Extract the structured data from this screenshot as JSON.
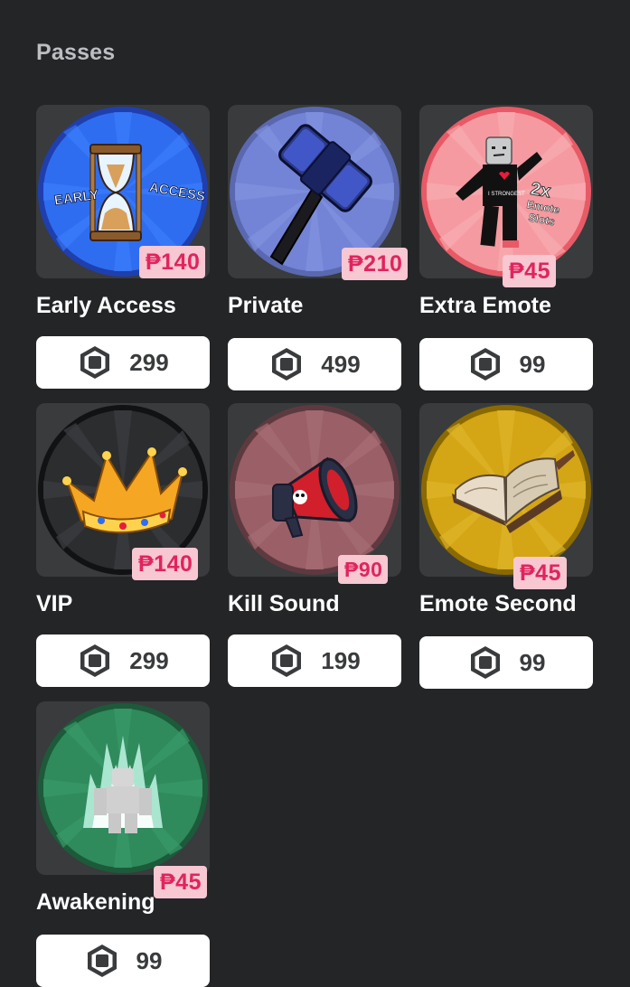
{
  "header": {
    "title": "Passes"
  },
  "colors": {
    "background": "#232527",
    "card": "#393b3d",
    "tag_bg": "#f7c7d2",
    "tag_text": "#e0245e"
  },
  "passes": [
    {
      "name": "Early Access",
      "php_price": "₱140",
      "robux_price": "299",
      "icon": "hourglass-icon",
      "badge_text": [
        "EARLY",
        "ACCESS"
      ]
    },
    {
      "name": "Private",
      "php_price": "₱210",
      "robux_price": "499",
      "icon": "hammer-icon"
    },
    {
      "name": "Extra Emote",
      "php_price": "₱45",
      "robux_price": "99",
      "icon": "dancing-avatar-icon",
      "badge_text": [
        "2x",
        "Emote",
        "Slots"
      ]
    },
    {
      "name": "VIP",
      "php_price": "₱140",
      "robux_price": "299",
      "icon": "crown-icon"
    },
    {
      "name": "Kill Sound",
      "php_price": "₱90",
      "robux_price": "199",
      "icon": "megaphone-icon"
    },
    {
      "name": "Emote Second",
      "php_price": "₱45",
      "robux_price": "99",
      "icon": "book-icon"
    },
    {
      "name": "Awakening",
      "php_price": "₱45",
      "robux_price": "99",
      "icon": "aura-figure-icon"
    }
  ],
  "robux_icon": "robux-icon"
}
